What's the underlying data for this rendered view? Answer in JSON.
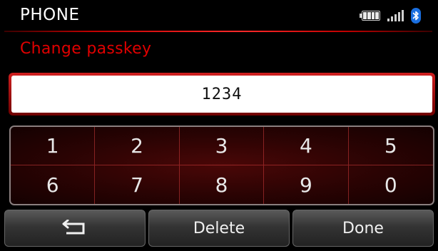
{
  "header": {
    "title": "PHONE"
  },
  "subtitle": "Change passkey",
  "passkey": {
    "value": "1234"
  },
  "keypad": {
    "row1": [
      "1",
      "2",
      "3",
      "4",
      "5"
    ],
    "row2": [
      "6",
      "7",
      "8",
      "9",
      "0"
    ]
  },
  "buttons": {
    "back_icon": "back-arrow-icon",
    "delete": "Delete",
    "done": "Done"
  },
  "status": {
    "battery_icon": "battery-icon",
    "signal_icon": "signal-strength-icon",
    "bluetooth_icon": "bluetooth-icon",
    "bluetooth_color": "#1a6fe0"
  }
}
